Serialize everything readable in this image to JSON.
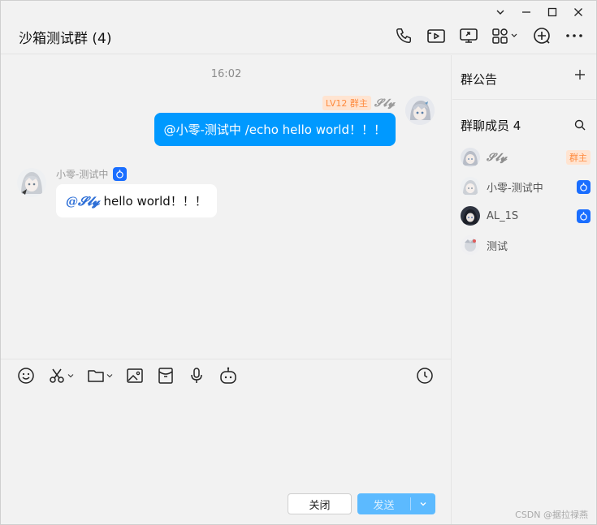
{
  "window": {
    "controls": [
      "chevron-down",
      "minimize",
      "maximize",
      "close"
    ]
  },
  "header": {
    "title": "沙箱测试群 (4)",
    "icons": [
      "phone-icon",
      "video-icon",
      "screen-share-icon",
      "apps-icon",
      "add-circle-icon",
      "more-icon"
    ]
  },
  "chat": {
    "time": "16:02",
    "self_message": {
      "level_badge": "LV12 群主",
      "sender": "𝓢𝓵𝔂",
      "text": "@小零-测试中 /echo hello world！！！"
    },
    "other_message": {
      "sender": "小零-测试中",
      "mention": "@𝓢𝓵𝔂",
      "text": " hello world！！！"
    }
  },
  "input": {
    "tools": [
      "emoji-icon",
      "scissors-icon",
      "folder-icon",
      "image-icon",
      "red-packet-icon",
      "microphone-icon",
      "robot-icon"
    ],
    "close_label": "关闭",
    "send_label": "发送"
  },
  "right_panel": {
    "announcement_title": "群公告",
    "members_title": "群聊成员 4",
    "members": [
      {
        "name": "𝓢𝓵𝔂",
        "tag": "群主"
      },
      {
        "name": "小零-测试中",
        "tag": "bot"
      },
      {
        "name": "AL_1S",
        "tag": "bot"
      },
      {
        "name": "测试",
        "tag": ""
      }
    ]
  },
  "watermark": "CSDN @据拉禄燕",
  "colors": {
    "accent": "#0099ff",
    "owner_tag_bg": "#ffe4d1",
    "owner_tag_text": "#ff8a3d",
    "bot_badge": "#1a6eff"
  }
}
